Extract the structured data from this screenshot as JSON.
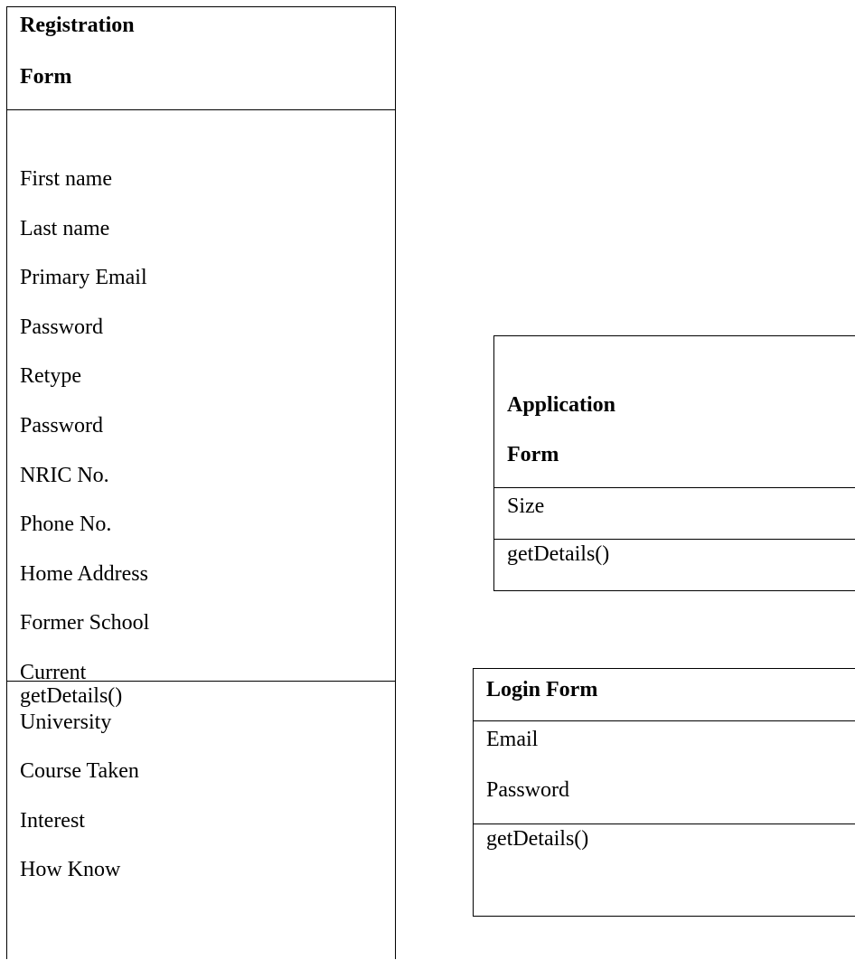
{
  "registration_form": {
    "name_lines": [
      "Registration",
      "Form"
    ],
    "attributes": [
      "First name",
      "Last name",
      "Primary Email",
      "Password",
      "Retype",
      "Password",
      "NRIC No.",
      "Phone No.",
      "Home Address",
      "Former School",
      "Current",
      "University",
      "Course Taken",
      "Interest",
      "How Know"
    ],
    "operations": [
      "getDetails()"
    ]
  },
  "application_form": {
    "name_lines": [
      "Application",
      "Form"
    ],
    "attributes": [
      "Size"
    ],
    "operations": [
      "getDetails()"
    ]
  },
  "login_form": {
    "name_lines": [
      "Login Form"
    ],
    "attributes": [
      "Email",
      "Password"
    ],
    "operations": [
      "getDetails()"
    ]
  }
}
